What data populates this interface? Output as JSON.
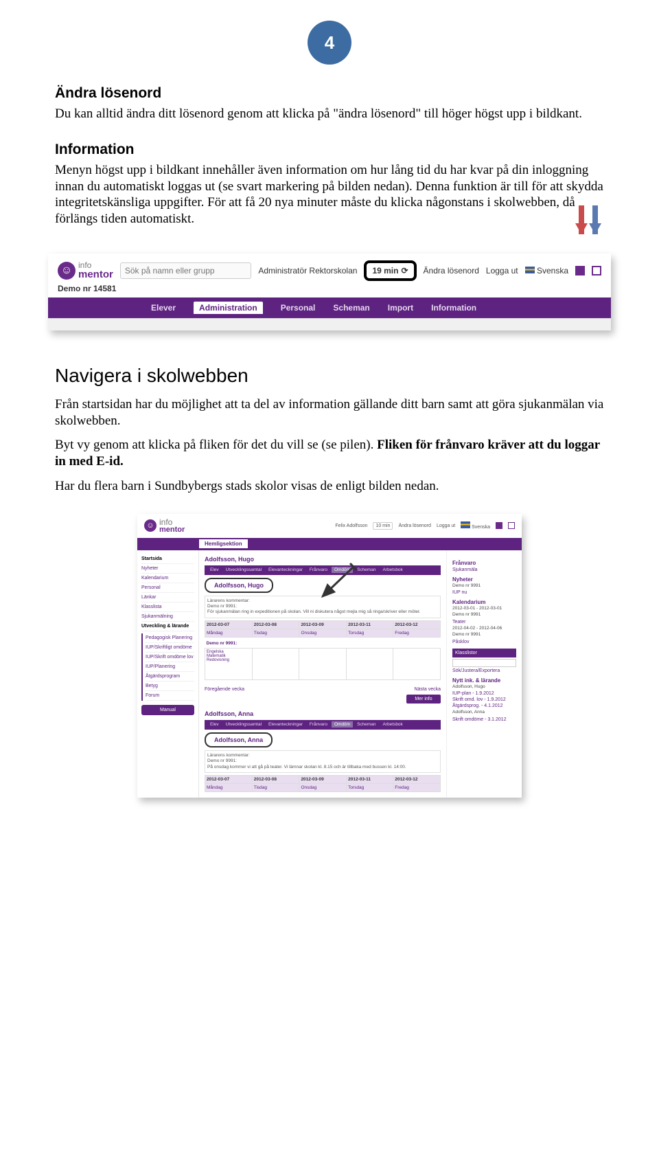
{
  "page_number": "4",
  "section1": {
    "heading": "Ändra lösenord",
    "body": "Du kan alltid ändra ditt lösenord genom att klicka på \"ändra lösenord\" till höger högst upp i bildkant."
  },
  "section2": {
    "heading": "Information",
    "body": "Menyn högst upp i bildkant innehåller även information om hur lång tid du har kvar på din inloggning innan du automatiskt loggas ut (se svart markering på bilden nedan). Denna funktion är till för att skydda integritetskänsliga uppgifter. För att få 20 nya minuter måste du klicka någonstans i skolwebben, då förlängs tiden automatiskt."
  },
  "banner": {
    "logo_top": "info",
    "logo_bottom": "mentor",
    "search_placeholder": "Sök på namn eller grupp",
    "user": "Administratör Rektorskolan",
    "timer": "19 min",
    "change_pw": "Ändra lösenord",
    "logout": "Logga ut",
    "lang": "Svenska",
    "sub": "Demo nr 14581",
    "menu": [
      "Elever",
      "Administration",
      "Personal",
      "Scheman",
      "Import",
      "Information"
    ]
  },
  "section3": {
    "heading": "Navigera i skolwebben",
    "p1": "Från startsidan har du möjlighet att ta del av information gällande ditt barn samt att göra sjukanmälan via skolwebben.",
    "p2a": "Byt vy genom att klicka på fliken för det du vill se (se pilen). ",
    "p2b": "Fliken för frånvaro kräver att du loggar in med E-id.",
    "p3": "Har du flera barn i Sundbybergs stads skolor visas de enligt bilden nedan."
  },
  "dash": {
    "topuser": "Felix Adolfsson",
    "toplinks": [
      "10 min",
      "Ändra lösenord",
      "Logga ut",
      "Svenska"
    ],
    "menu_active": "Hemligsektion",
    "side": {
      "head_items": [
        "Startsida",
        "Nyheter",
        "Kalendarium",
        "Personal",
        "Länkar",
        "Klasslista",
        "Sjukanmälning"
      ],
      "group_head": "Utveckling & lärande",
      "group_items": [
        "Pedagogisk Planering",
        "IUP/Skriftligt omdöme",
        "IUP/Skrift omdöme lov",
        "IUP/Planering",
        "Åtgärdsprogram",
        "Betyg",
        "Forum"
      ],
      "btn": "Manual"
    },
    "main": {
      "name1": "Adolfsson, Hugo",
      "tabs": [
        "Elev",
        "Utvecklingssamtal",
        "Elevanteckningar",
        "Frånvaro",
        "Omdöm",
        "Scheman",
        "Arbetsbok"
      ],
      "callout1": "Adolfsson, Hugo",
      "comment_label": "Lärarens kommentar:",
      "comment_unit": "Demo nr 9991:",
      "comment_text": "För sjukanmälan ring in expeditionen på skolan. Vill ni diskutera något mejla mig så ringa/skriver eller möter.",
      "week": {
        "dates": [
          "2012-03-07",
          "2012-03-08",
          "2012-03-09",
          "2012-03-11",
          "2012-03-12"
        ],
        "days": [
          "Måndag",
          "Tisdag",
          "Onsdag",
          "Torsdag",
          "Fredag"
        ],
        "unit_label": "Demo nr 9991:",
        "cell_items": [
          "Engelska",
          "Matematik",
          "Redovisning"
        ]
      },
      "prev": "Föregående vecka",
      "next": "Nästa vecka",
      "more": "Mer info",
      "name2": "Adolfsson, Anna",
      "callout2": "Adolfsson, Anna",
      "comment2_label": "Lärarens kommentar:",
      "comment2_unit": "Demo nr 9991:",
      "comment2_text": "På onsdag kommer vi att gå på teater. Vi lämnar skolan kl. 8.15 och är tillbaka med bussen kl. 14:00.",
      "week2": {
        "dates": [
          "2012-03-07",
          "2012-03-08",
          "2012-03-09",
          "2012-03-11",
          "2012-03-12"
        ],
        "days": [
          "Måndag",
          "Tisdag",
          "Onsdag",
          "Torsdag",
          "Fredag"
        ]
      }
    },
    "right": {
      "r1": "Frånvaro",
      "r1_link": "Sjukanmäla",
      "r2": "Nyheter",
      "r2_a": "Demo nr 9991",
      "r2_b": "IUP nu",
      "r3": "Kalendarium",
      "r3_a": "2012-03-01 - 2012-03-01",
      "r3_b": "Demo nr 9991",
      "r3_c": "Teater",
      "r3_d": "2012-04-02 - 2012-04-06",
      "r3_e": "Demo nr 9991",
      "r3_f": "Påsklov",
      "box": "Klasslistor",
      "box_link": "Sök/Justera/Exportera",
      "r4": "Nytt ink. & lärande",
      "r4_a": "Adolfsson, Hugo",
      "r4_b": "IUP-plan  - 1.9.2012",
      "r4_c": "Skrift omd. lov - 1.9.2012",
      "r4_d": "Åtgärdsprog. - 4.1.2012",
      "r4_e": "Adolfsson, Anna",
      "r4_f": "Skrift omdöme - 3.1.2012"
    }
  }
}
